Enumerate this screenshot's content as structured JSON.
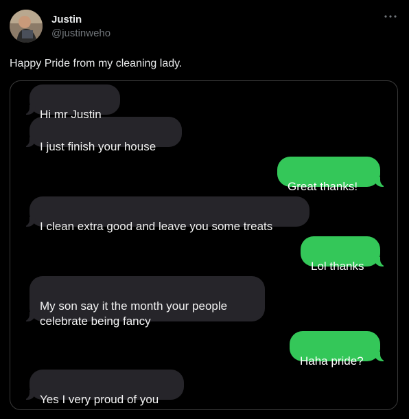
{
  "tweet": {
    "author_name": "Justin",
    "author_handle": "@justinweho",
    "more_icon": "more-icon",
    "text": "Happy Pride from my cleaning lady."
  },
  "messages": [
    {
      "side": "in",
      "text": "Hi mr Justin"
    },
    {
      "side": "in",
      "text": "I just finish your house"
    },
    {
      "side": "out",
      "text": "Great thanks!"
    },
    {
      "side": "in",
      "text": "I clean extra good and leave you some treats"
    },
    {
      "side": "out",
      "text": "Lol thanks"
    },
    {
      "side": "in",
      "text": "My son say it the month your people\ncelebrate being fancy"
    },
    {
      "side": "out",
      "text": "Haha pride?"
    },
    {
      "side": "in",
      "text": "Yes I very proud of you"
    }
  ],
  "colors": {
    "incoming_bubble": "#26252a",
    "outgoing_bubble": "#34c759"
  }
}
